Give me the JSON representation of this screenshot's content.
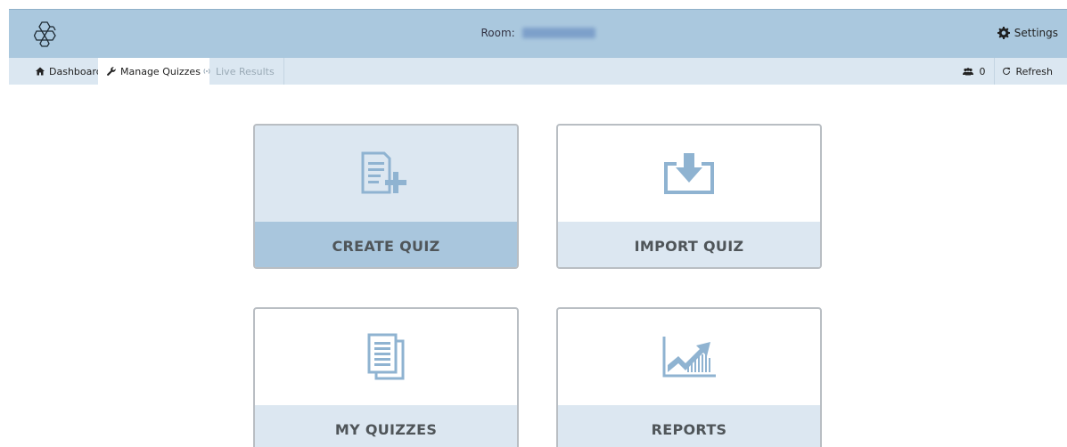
{
  "header": {
    "room_label": "Room:",
    "room_name": "",
    "settings_label": "Settings"
  },
  "nav": {
    "tabs": [
      {
        "label": "Dashboard",
        "icon": "home-icon"
      },
      {
        "label": "Manage Quizzes",
        "icon": "wrench-icon",
        "active": true
      },
      {
        "label": "Live Results",
        "icon": "signal-icon",
        "disabled": true
      }
    ],
    "user_count": "0",
    "refresh_label": "Refresh"
  },
  "cards": [
    {
      "label": "CREATE QUIZ",
      "icon": "create-quiz-icon",
      "active": true
    },
    {
      "label": "IMPORT QUIZ",
      "icon": "import-icon"
    },
    {
      "label": "MY QUIZZES",
      "icon": "documents-icon"
    },
    {
      "label": "REPORTS",
      "icon": "chart-icon"
    }
  ],
  "colors": {
    "topbar": "#aac8de",
    "subnav": "#dbe7f1",
    "card_label_bg": "#dce7f1",
    "card_active_label_bg": "#a9c6dd",
    "icon_blue": "#8fb3d1"
  }
}
